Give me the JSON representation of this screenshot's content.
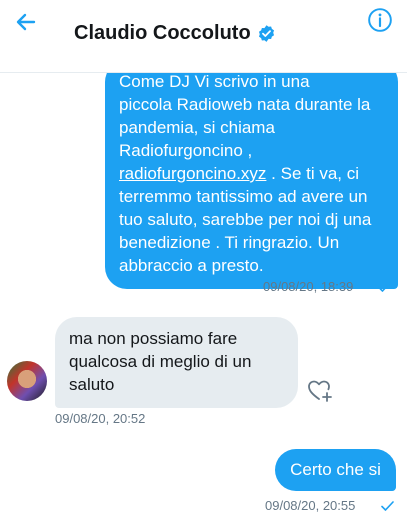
{
  "header": {
    "contact_name": "Claudio Coccoluto",
    "verified": true
  },
  "conversation": {
    "messages": [
      {
        "direction": "outgoing",
        "lines": [
          "Come DJ Vi scrivo in una",
          "piccola Radioweb nata durante la pandemia, si chiama Radiofurgoncino ,",
          "radiofurgoncino.xyz",
          ". Se ti va, ci terremmo tantissimo ad avere un tuo saluto, sarebbe per noi dj una benedizione . Ti ringrazio. Un abbraccio a presto."
        ],
        "timestamp": "09/08/20, 18:39"
      },
      {
        "direction": "incoming",
        "text": "ma non possiamo fare qualcosa di meglio di un saluto",
        "timestamp": "09/08/20, 20:52"
      },
      {
        "direction": "outgoing",
        "text": "Certo che si",
        "timestamp": "09/08/20, 20:55"
      }
    ]
  },
  "colors": {
    "accent": "#1da1f2",
    "incoming_bubble": "#e6ecf0",
    "meta_text": "#657786"
  },
  "icons": {
    "back": "arrow-left-icon",
    "verified": "verified-badge-icon",
    "info": "info-icon",
    "sent": "checkmark-icon",
    "react": "heart-plus-icon"
  }
}
